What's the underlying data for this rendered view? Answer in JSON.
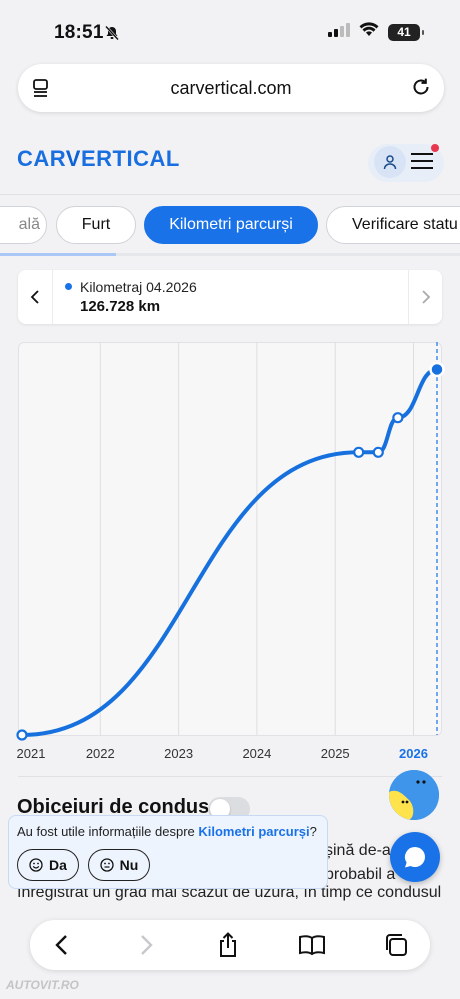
{
  "status_bar": {
    "time": "18:51",
    "battery": "41"
  },
  "browser": {
    "url": "carvertical.com"
  },
  "site": {
    "logo_left": "CAR",
    "logo_v": "V",
    "logo_right": "ERTICAL"
  },
  "tabs": [
    {
      "label": "ală"
    },
    {
      "label": "Furt"
    },
    {
      "label": "Kilometri parcurși"
    },
    {
      "label": "Verificare statu"
    }
  ],
  "tooltip": {
    "label": "Kilometraj 04.2026",
    "value": "126.728 km"
  },
  "colors": {
    "accent": "#1a72e8",
    "line": "#1670de"
  },
  "chart_data": {
    "type": "line",
    "x_tick_labels": [
      "2021",
      "2022",
      "2023",
      "2024",
      "2025",
      "2026"
    ],
    "highlighted_tick": "2026",
    "grid": true,
    "series": [
      {
        "x": [
          2021.0,
          2025.3,
          2025.55,
          2025.8,
          2026.3
        ],
        "y": [
          0,
          98000,
          98000,
          110000,
          126728
        ],
        "markers": true
      }
    ],
    "ylim": [
      0,
      130000
    ],
    "xlim": [
      2021.0,
      2026.3
    ],
    "selected_point": {
      "x": 2026.3,
      "y": 126728
    }
  },
  "section": {
    "title": "Obiceiuri de condus",
    "line1_end": "șină de-a",
    "line2_end": "probabil a",
    "line3": "înregistrat un grad mai scăzut de uzură, în timp ce condusul"
  },
  "feedback": {
    "question_prefix": "Au fost utile informațiile despre ",
    "question_link": "Kilometri parcurși",
    "question_suffix": "?",
    "yes": "Da",
    "no": "Nu"
  },
  "watermark": "AUTOVIT.RO"
}
